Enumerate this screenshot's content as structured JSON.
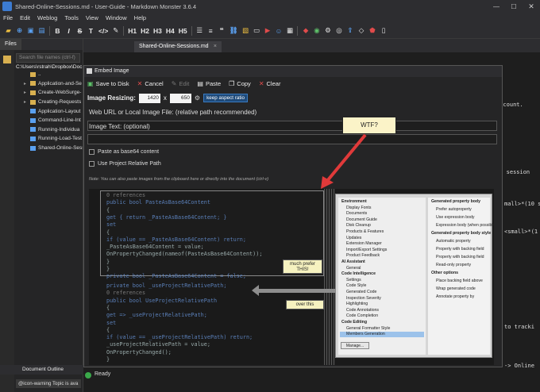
{
  "window": {
    "title": "Shared-Online-Sessions.md  -  User-Guide  -  Markdown Monster 3.6.4",
    "minimize_glyph": "—",
    "maximize_glyph": "☐",
    "close_glyph": "✕"
  },
  "menu": [
    "File",
    "Edit",
    "Weblog",
    "Tools",
    "View",
    "Window",
    "Help"
  ],
  "toolbar": {
    "bold": "B",
    "italic": "I",
    "strike": "S",
    "text": "T",
    "code": "</>",
    "h1": "H1",
    "h2": "H2",
    "h3": "H3",
    "h4": "H4",
    "h5": "H5"
  },
  "sidebar": {
    "tab_label": "Files",
    "search_placeholder": "Search file names (ctrl-f)",
    "path": "C:\\Users\\rstrah\\Dropbox\\Doc",
    "items": [
      {
        "label": "..",
        "type": "folder",
        "expanded": false
      },
      {
        "label": "Application-and-Se",
        "type": "folder",
        "expanded": false
      },
      {
        "label": "Create-WebSurge-",
        "type": "folder",
        "expanded": false
      },
      {
        "label": "Creating-Requests",
        "type": "folder",
        "expanded": false
      },
      {
        "label": "Application-Layout",
        "type": "file",
        "expanded": false
      },
      {
        "label": "Command-Line-Int",
        "type": "file",
        "expanded": false
      },
      {
        "label": "Running-Individua",
        "type": "file",
        "expanded": false
      },
      {
        "label": "Running-Load-Test",
        "type": "file",
        "expanded": false
      },
      {
        "label": "Shared-Online-Sess",
        "type": "file",
        "expanded": false
      }
    ],
    "document_outline_label": "Document Outline",
    "status_snippet": "@icon-warning Topic is ava"
  },
  "editor": {
    "tab_label": "Shared-Online-Sessions.md",
    "tab_close": "×",
    "fragments": [
      {
        "text": "account.",
        "color": "#cfcfcf"
      },
      {
        "text": "ed session",
        "color": "#d070d0"
      },
      {
        "text": "mall>*(10 s",
        "color": "#d070d0"
      },
      {
        "text": "<small>*(1",
        "color": "#d070d0"
      },
      {
        "text": "to tracki",
        "color": "#cfcfcf"
      },
      {
        "text": "-> Online",
        "color": "#5aa0f0"
      }
    ]
  },
  "status": {
    "text": "Ready"
  },
  "dialog": {
    "title": "Embed Image",
    "save_to_disk": "Save to Disk",
    "cancel": "Cancel",
    "edit": "Edit",
    "paste": "Paste",
    "copy": "Copy",
    "clear": "Clear",
    "resizing_label": "Image Resizing:",
    "width": "1420",
    "x": "x",
    "height": "650",
    "keep_aspect": "keep aspect ratio",
    "url_label": "Web URL or Local Image File: (relative path recommended)",
    "url_value": "",
    "text_label": "Image Text: (optional)",
    "text_value": "",
    "paste_base64": "Paste as base64 content",
    "use_relative": "Use Project Relative Path",
    "note": "Note: You can also paste images from the clipboard here or directly into the document (ctrl-v)"
  },
  "annotation": {
    "wtf": "WTF?"
  },
  "preview": {
    "code_lines": [
      {
        "text": "0 references",
        "cls": "dm"
      },
      {
        "text": "public bool PasteAsBase64Content",
        "cls": "kw"
      },
      {
        "text": "{",
        "cls": "pl"
      },
      {
        "text": "    get { return _PasteAsBase64Content; }",
        "cls": "kw"
      },
      {
        "text": "    set",
        "cls": "kw"
      },
      {
        "text": "    {",
        "cls": "pl"
      },
      {
        "text": "        if (value == _PasteAsBase64Content) return;",
        "cls": "kw"
      },
      {
        "text": "        _PasteAsBase64Content = value;",
        "cls": "pl"
      },
      {
        "text": "        OnPropertyChanged(nameof(PasteAsBase64Content));",
        "cls": "pl"
      },
      {
        "text": "    }",
        "cls": "pl"
      },
      {
        "text": "}",
        "cls": "pl"
      },
      {
        "text": "private bool _PasteAsBase64Content = false;",
        "cls": "kw"
      }
    ],
    "code_lines_2": [
      {
        "text": "private bool _useProjectRelativePath;",
        "cls": "kw"
      },
      {
        "text": "0 references",
        "cls": "dm"
      },
      {
        "text": "public bool UseProjectRelativePath",
        "cls": "kw"
      },
      {
        "text": "{",
        "cls": "pl"
      },
      {
        "text": "    get => _useProjectRelativePath;",
        "cls": "kw"
      },
      {
        "text": "    set",
        "cls": "kw"
      },
      {
        "text": "    {",
        "cls": "pl"
      },
      {
        "text": "        if (value == _useProjectRelativePath) return;",
        "cls": "kw"
      },
      {
        "text": "        _useProjectRelativePath = value;",
        "cls": "pl"
      },
      {
        "text": "        OnPropertyChanged();",
        "cls": "pl"
      },
      {
        "text": "    }",
        "cls": "pl"
      }
    ],
    "callout_1": "much prefer THIS!",
    "callout_2": "over this",
    "settings_left": [
      {
        "text": "Environment",
        "hdr": true
      },
      {
        "text": "Display Fonts",
        "hdr": false
      },
      {
        "text": "Documents",
        "hdr": false
      },
      {
        "text": "Document Guide",
        "hdr": false
      },
      {
        "text": "Disk Cleanup",
        "hdr": false
      },
      {
        "text": "Products & Features",
        "hdr": false
      },
      {
        "text": "Updates",
        "hdr": false
      },
      {
        "text": "Extension Manager",
        "hdr": false
      },
      {
        "text": "Import/Export Settings",
        "hdr": false
      },
      {
        "text": "Product Feedback",
        "hdr": false
      },
      {
        "text": "AI Assistant",
        "hdr": true
      },
      {
        "text": "General",
        "hdr": false
      },
      {
        "text": "Code Intelligence",
        "hdr": true
      },
      {
        "text": "Settings",
        "hdr": false
      },
      {
        "text": "Code Style",
        "hdr": false
      },
      {
        "text": "Generated Code",
        "hdr": false
      },
      {
        "text": "Inspection Severity",
        "hdr": false
      },
      {
        "text": "Highlighting",
        "hdr": false
      },
      {
        "text": "Code Annotations",
        "hdr": false
      },
      {
        "text": "Code Completion",
        "hdr": false
      },
      {
        "text": "Code Editing",
        "hdr": true
      },
      {
        "text": "General Formatter Style",
        "hdr": false
      },
      {
        "text": "Members Generation",
        "hdr": false
      }
    ],
    "settings_right": [
      {
        "text": "Generated property body",
        "hdr": true
      },
      {
        "text": "Prefer autoproperty",
        "hdr": false
      },
      {
        "text": "Use expression body",
        "hdr": false
      },
      {
        "text": "Expression body (when possible)",
        "hdr": false
      },
      {
        "text": "Generated property body style",
        "hdr": true
      },
      {
        "text": "Automatic property",
        "hdr": false
      },
      {
        "text": "Property with backing field",
        "hdr": false
      },
      {
        "text": "Property with backing field",
        "hdr": false
      },
      {
        "text": "Read-only property",
        "hdr": false
      },
      {
        "text": "Other options",
        "hdr": true
      },
      {
        "text": "Place backing field above",
        "hdr": false
      },
      {
        "text": "Wrap generated code",
        "hdr": false
      },
      {
        "text": "Annotate property by",
        "hdr": false
      }
    ],
    "manage_btn": "Manage..."
  }
}
